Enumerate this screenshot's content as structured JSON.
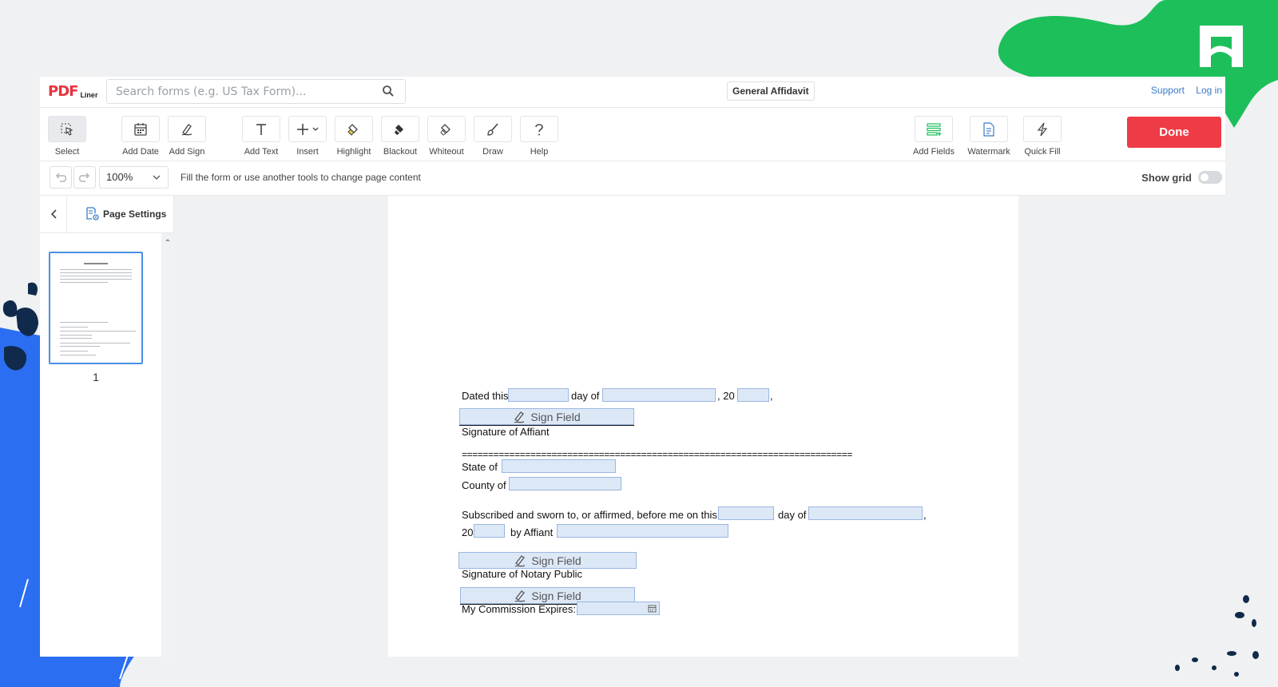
{
  "header": {
    "logo_main": "PDF",
    "logo_sub": "Liner",
    "search_placeholder": "Search forms (e.g. US Tax Form)...",
    "doc_title": "General Affidavit",
    "support": "Support",
    "login": "Log in"
  },
  "toolbar": {
    "select": "Select",
    "add_date": "Add Date",
    "add_sign": "Add Sign",
    "add_text": "Add Text",
    "insert": "Insert",
    "highlight": "Highlight",
    "blackout": "Blackout",
    "whiteout": "Whiteout",
    "draw": "Draw",
    "help": "Help",
    "add_fields": "Add Fields",
    "watermark": "Watermark",
    "quick_fill": "Quick Fill",
    "done": "Done"
  },
  "subbar": {
    "zoom": "100%",
    "hint": "Fill the form or use another tools to change page content",
    "show_grid": "Show grid",
    "show_grid_on": false
  },
  "sidebar": {
    "page_settings": "Page Settings",
    "page_number": "1"
  },
  "document": {
    "dated_this": "Dated this",
    "day_of": "day of",
    "year_prefix": ", 20",
    "comma": ",",
    "sign_field": "Sign Field",
    "signature_affiant": "Signature of Affiant",
    "separator": "==========================================================================",
    "state_of": "State of",
    "county_of": "County of",
    "subscribed": "Subscribed and sworn to, or affirmed, before me on this",
    "day_of_2": "day of",
    "twenty": "20",
    "by_affiant": "by Affiant",
    "signature_notary": "Signature of Notary Public",
    "commission_expires": "My Commission Expires:"
  },
  "colors": {
    "brand_red": "#ee3b45",
    "accent_blue": "#3a7ac8",
    "field_fill": "#dde8f7",
    "deco_green": "#1dbf5b",
    "deco_blue": "#2b6ef2",
    "deco_navy": "#0f2a4a"
  }
}
